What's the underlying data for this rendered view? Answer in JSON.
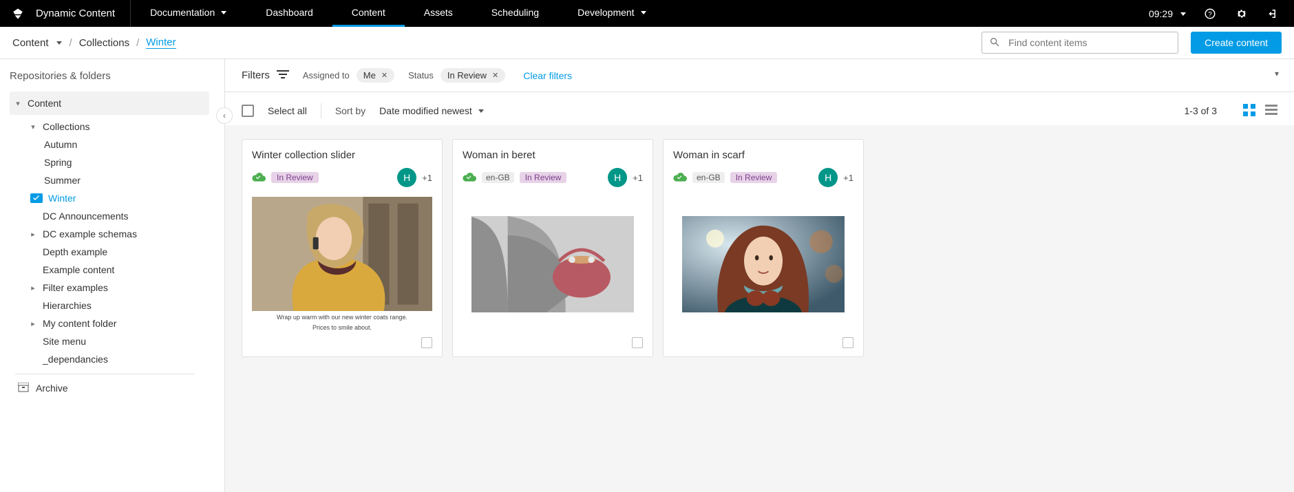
{
  "brand": "Dynamic Content",
  "clock": "09:29",
  "topnav": {
    "documentation": "Documentation",
    "dashboard": "Dashboard",
    "content": "Content",
    "assets": "Assets",
    "scheduling": "Scheduling",
    "development": "Development"
  },
  "breadcrumb": {
    "root": "Content",
    "mid": "Collections",
    "current": "Winter"
  },
  "search": {
    "placeholder": "Find content items"
  },
  "create_btn": "Create content",
  "sidebar": {
    "title": "Repositories & folders",
    "root": "Content",
    "collections": "Collections",
    "items": [
      {
        "label": "Autumn"
      },
      {
        "label": "Spring"
      },
      {
        "label": "Summer"
      },
      {
        "label": "Winter"
      }
    ],
    "nodes": {
      "announcements": "DC Announcements",
      "example_schemas": "DC example schemas",
      "depth_example": "Depth example",
      "example_content": "Example content",
      "filter_examples": "Filter examples",
      "hierarchies": "Hierarchies",
      "my_content": "My content folder",
      "site_menu": "Site menu",
      "dependancies": "_dependancies"
    },
    "archive": "Archive"
  },
  "filters": {
    "label": "Filters",
    "assigned_key": "Assigned to",
    "assigned_val": "Me",
    "status_key": "Status",
    "status_val": "In Review",
    "clear": "Clear filters"
  },
  "sort": {
    "select_all": "Select all",
    "sort_by": "Sort by",
    "value": "Date modified newest",
    "count": "1-3 of 3"
  },
  "cards": [
    {
      "title": "Winter collection slider",
      "locale": "",
      "status": "In Review",
      "avatar_initial": "H",
      "extra_count": "+1",
      "caption1": "Wrap up warm with our new winter coats range.",
      "caption2": "Prices to smile about."
    },
    {
      "title": "Woman in beret",
      "locale": "en-GB",
      "status": "In Review",
      "avatar_initial": "H",
      "extra_count": "+1"
    },
    {
      "title": "Woman in scarf",
      "locale": "en-GB",
      "status": "In Review",
      "avatar_initial": "H",
      "extra_count": "+1"
    }
  ]
}
